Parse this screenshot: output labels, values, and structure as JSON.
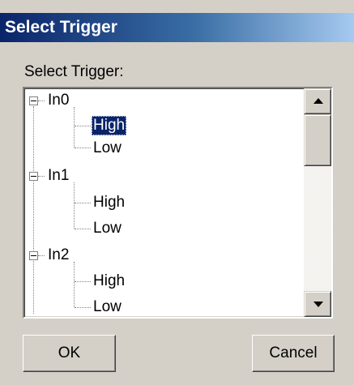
{
  "window": {
    "title": "Select Trigger",
    "colors": {
      "face": "#d4d0c8",
      "title_start": "#0a246a",
      "title_end": "#a6caf0",
      "selection": "#0a246a"
    }
  },
  "prompt": {
    "label": "Select Trigger:"
  },
  "tree": {
    "nodes": [
      {
        "label": "In0",
        "expanded": true,
        "children": [
          {
            "label": "High",
            "selected": true
          },
          {
            "label": "Low",
            "selected": false
          }
        ]
      },
      {
        "label": "In1",
        "expanded": true,
        "children": [
          {
            "label": "High",
            "selected": false
          },
          {
            "label": "Low",
            "selected": false
          }
        ]
      },
      {
        "label": "In2",
        "expanded": true,
        "children": [
          {
            "label": "High",
            "selected": false
          },
          {
            "label": "Low",
            "selected": false
          }
        ]
      }
    ]
  },
  "scrollbar": {
    "icons": [
      "scroll-up-arrow-icon",
      "scroll-down-arrow-icon"
    ],
    "scroll_fraction": 0.0
  },
  "buttons": {
    "ok_label": "OK",
    "cancel_label": "Cancel"
  }
}
